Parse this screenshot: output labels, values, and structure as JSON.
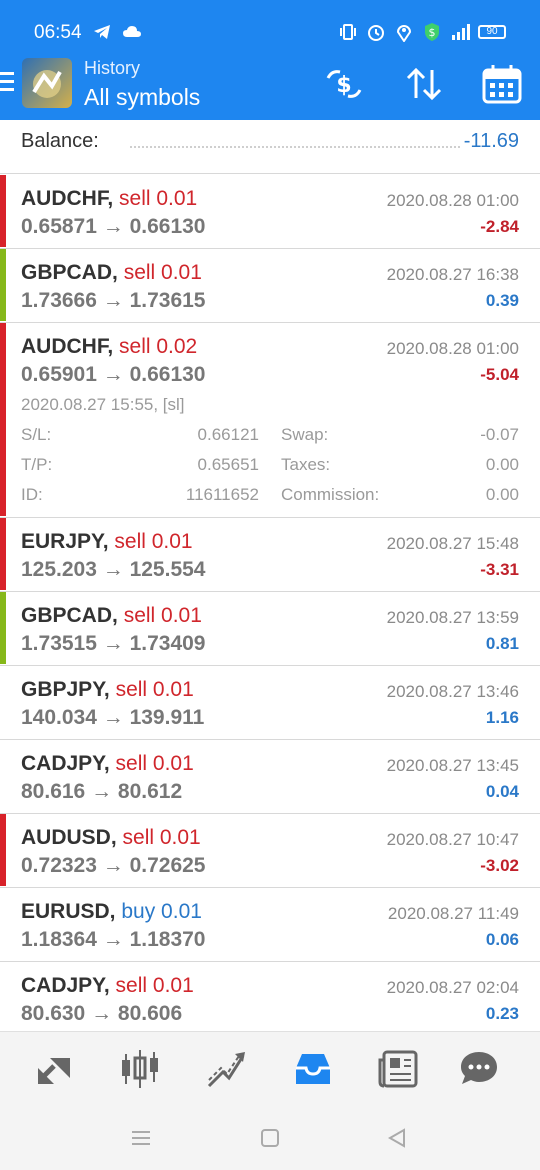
{
  "status_bar": {
    "time": "06:54",
    "battery": "90"
  },
  "app_bar": {
    "subtitle": "History",
    "title": "All symbols"
  },
  "balance": {
    "label": "Balance:",
    "value": "-11.69"
  },
  "deals": [
    {
      "symbol": "AUDCHF,",
      "side": "sell 0.01",
      "side_type": "sell",
      "prices": "0.65871 → 0.66130",
      "date": "2020.08.28 01:00",
      "profit": "-2.84",
      "profit_sign": "neg",
      "bar_color": "#d8222a"
    },
    {
      "symbol": "GBPCAD,",
      "side": "sell 0.01",
      "side_type": "sell",
      "prices": "1.73666 → 1.73615",
      "date": "2020.08.27 16:38",
      "profit": "0.39",
      "profit_sign": "pos",
      "bar_color": "#86b81a"
    },
    {
      "symbol": "AUDCHF,",
      "side": "sell 0.02",
      "side_type": "sell",
      "prices": "0.65901 → 0.66130",
      "date": "2020.08.28 01:00",
      "profit": "-5.04",
      "profit_sign": "neg",
      "bar_color": "#d8222a",
      "details": {
        "open_time": "2020.08.27 15:55, [sl]",
        "sl_label": "S/L:",
        "sl_value": "0.66121",
        "tp_label": "T/P:",
        "tp_value": "0.65651",
        "id_label": "ID:",
        "id_value": "11611652",
        "swap_label": "Swap:",
        "swap_value": "-0.07",
        "taxes_label": "Taxes:",
        "taxes_value": "0.00",
        "commission_label": "Commission:",
        "commission_value": "0.00"
      }
    },
    {
      "symbol": "EURJPY,",
      "side": "sell 0.01",
      "side_type": "sell",
      "prices": "125.203 → 125.554",
      "date": "2020.08.27 15:48",
      "profit": "-3.31",
      "profit_sign": "neg",
      "bar_color": "#d8222a"
    },
    {
      "symbol": "GBPCAD,",
      "side": "sell 0.01",
      "side_type": "sell",
      "prices": "1.73515 → 1.73409",
      "date": "2020.08.27 13:59",
      "profit": "0.81",
      "profit_sign": "pos",
      "bar_color": "#86b81a"
    },
    {
      "symbol": "GBPJPY,",
      "side": "sell 0.01",
      "side_type": "sell",
      "prices": "140.034 → 139.911",
      "date": "2020.08.27 13:46",
      "profit": "1.16",
      "profit_sign": "pos",
      "bar_color": ""
    },
    {
      "symbol": "CADJPY,",
      "side": "sell 0.01",
      "side_type": "sell",
      "prices": "80.616 → 80.612",
      "date": "2020.08.27 13:45",
      "profit": "0.04",
      "profit_sign": "pos",
      "bar_color": ""
    },
    {
      "symbol": "AUDUSD,",
      "side": "sell 0.01",
      "side_type": "sell",
      "prices": "0.72323 → 0.72625",
      "date": "2020.08.27 10:47",
      "profit": "-3.02",
      "profit_sign": "neg",
      "bar_color": "#d8222a"
    },
    {
      "symbol": "EURUSD,",
      "side": "buy 0.01",
      "side_type": "buy",
      "prices": "1.18364 → 1.18370",
      "date": "2020.08.27 11:49",
      "profit": "0.06",
      "profit_sign": "pos",
      "bar_color": ""
    },
    {
      "symbol": "CADJPY,",
      "side": "sell 0.01",
      "side_type": "sell",
      "prices": "80.630 → 80.606",
      "date": "2020.08.27 02:04",
      "profit": "0.23",
      "profit_sign": "pos",
      "bar_color": ""
    }
  ],
  "bottom_nav": [
    "quotes-icon",
    "chart-candles-icon",
    "trade-icon",
    "history-inbox-icon",
    "news-icon",
    "chat-icon"
  ],
  "colors": {
    "accent": "#1e86f0",
    "active_nav": "#1e86f0",
    "sell": "#d0262c",
    "buy": "#2a78c8"
  }
}
